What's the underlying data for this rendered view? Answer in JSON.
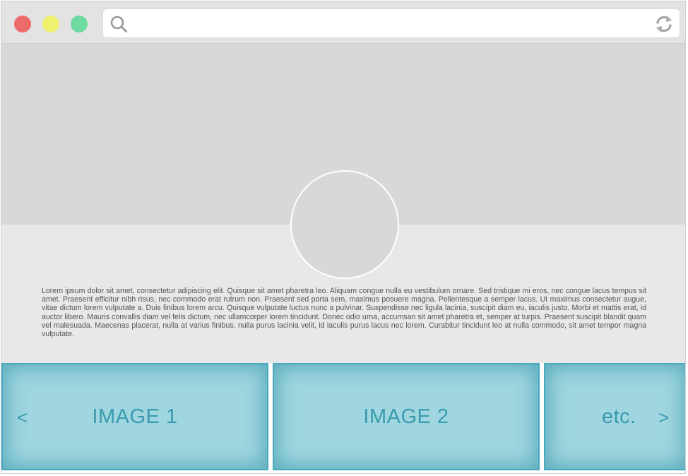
{
  "window": {
    "controls": {
      "close_color": "#ef6a6a",
      "minimize_color": "#eff06f",
      "maximize_color": "#6ddba0"
    },
    "address_bar": {
      "value": "",
      "search_icon": "search-icon",
      "refresh_icon": "refresh-icon"
    }
  },
  "profile": {
    "avatar_icon": "avatar-placeholder"
  },
  "body_text": "Lorem ipsum dolor sit amet, consectetur adipiscing elit. Quisque sit amet pharetra leo. Aliquam congue nulla eu vestibulum ornare. Sed tristique mi eros, nec congue lacus tempus sit amet. Praesent efficitur nibh risus, nec commodo erat rutrum non. Praesent sed porta sem, maximus posuere magna. Pellentesque a semper lacus. Ut maximus consectetur augue, vitae dictum lorem vulputate a. Duis finibus lorem arcu. Quisque vulputate luctus nunc a pulvinar. Suspendisse nec ligula lacinia, suscipit diam eu, iaculis justo. Morbi et mattis erat, id auctor libero. Mauris convallis diam vel felis dictum, nec ullamcorper lorem tincidunt. Donec odio urna, accumsan sit amet pharetra et, semper at turpis. Praesent suscipit blandit quam vel malesuada. Maecenas placerat, nulla at varius finibus, nulla purus lacinia velit, id iaculis purus lacus nec lorem. Curabitur tincidunt leo at nulla commodo, sit amet tempor magna vulputate.",
  "carousel": {
    "prev_label": "<",
    "next_label": ">",
    "slides": [
      {
        "label": "IMAGE 1"
      },
      {
        "label": "IMAGE 2"
      },
      {
        "label": "etc."
      }
    ],
    "slide_color": "#9fd6df",
    "accent_color": "#3a9ab0"
  }
}
